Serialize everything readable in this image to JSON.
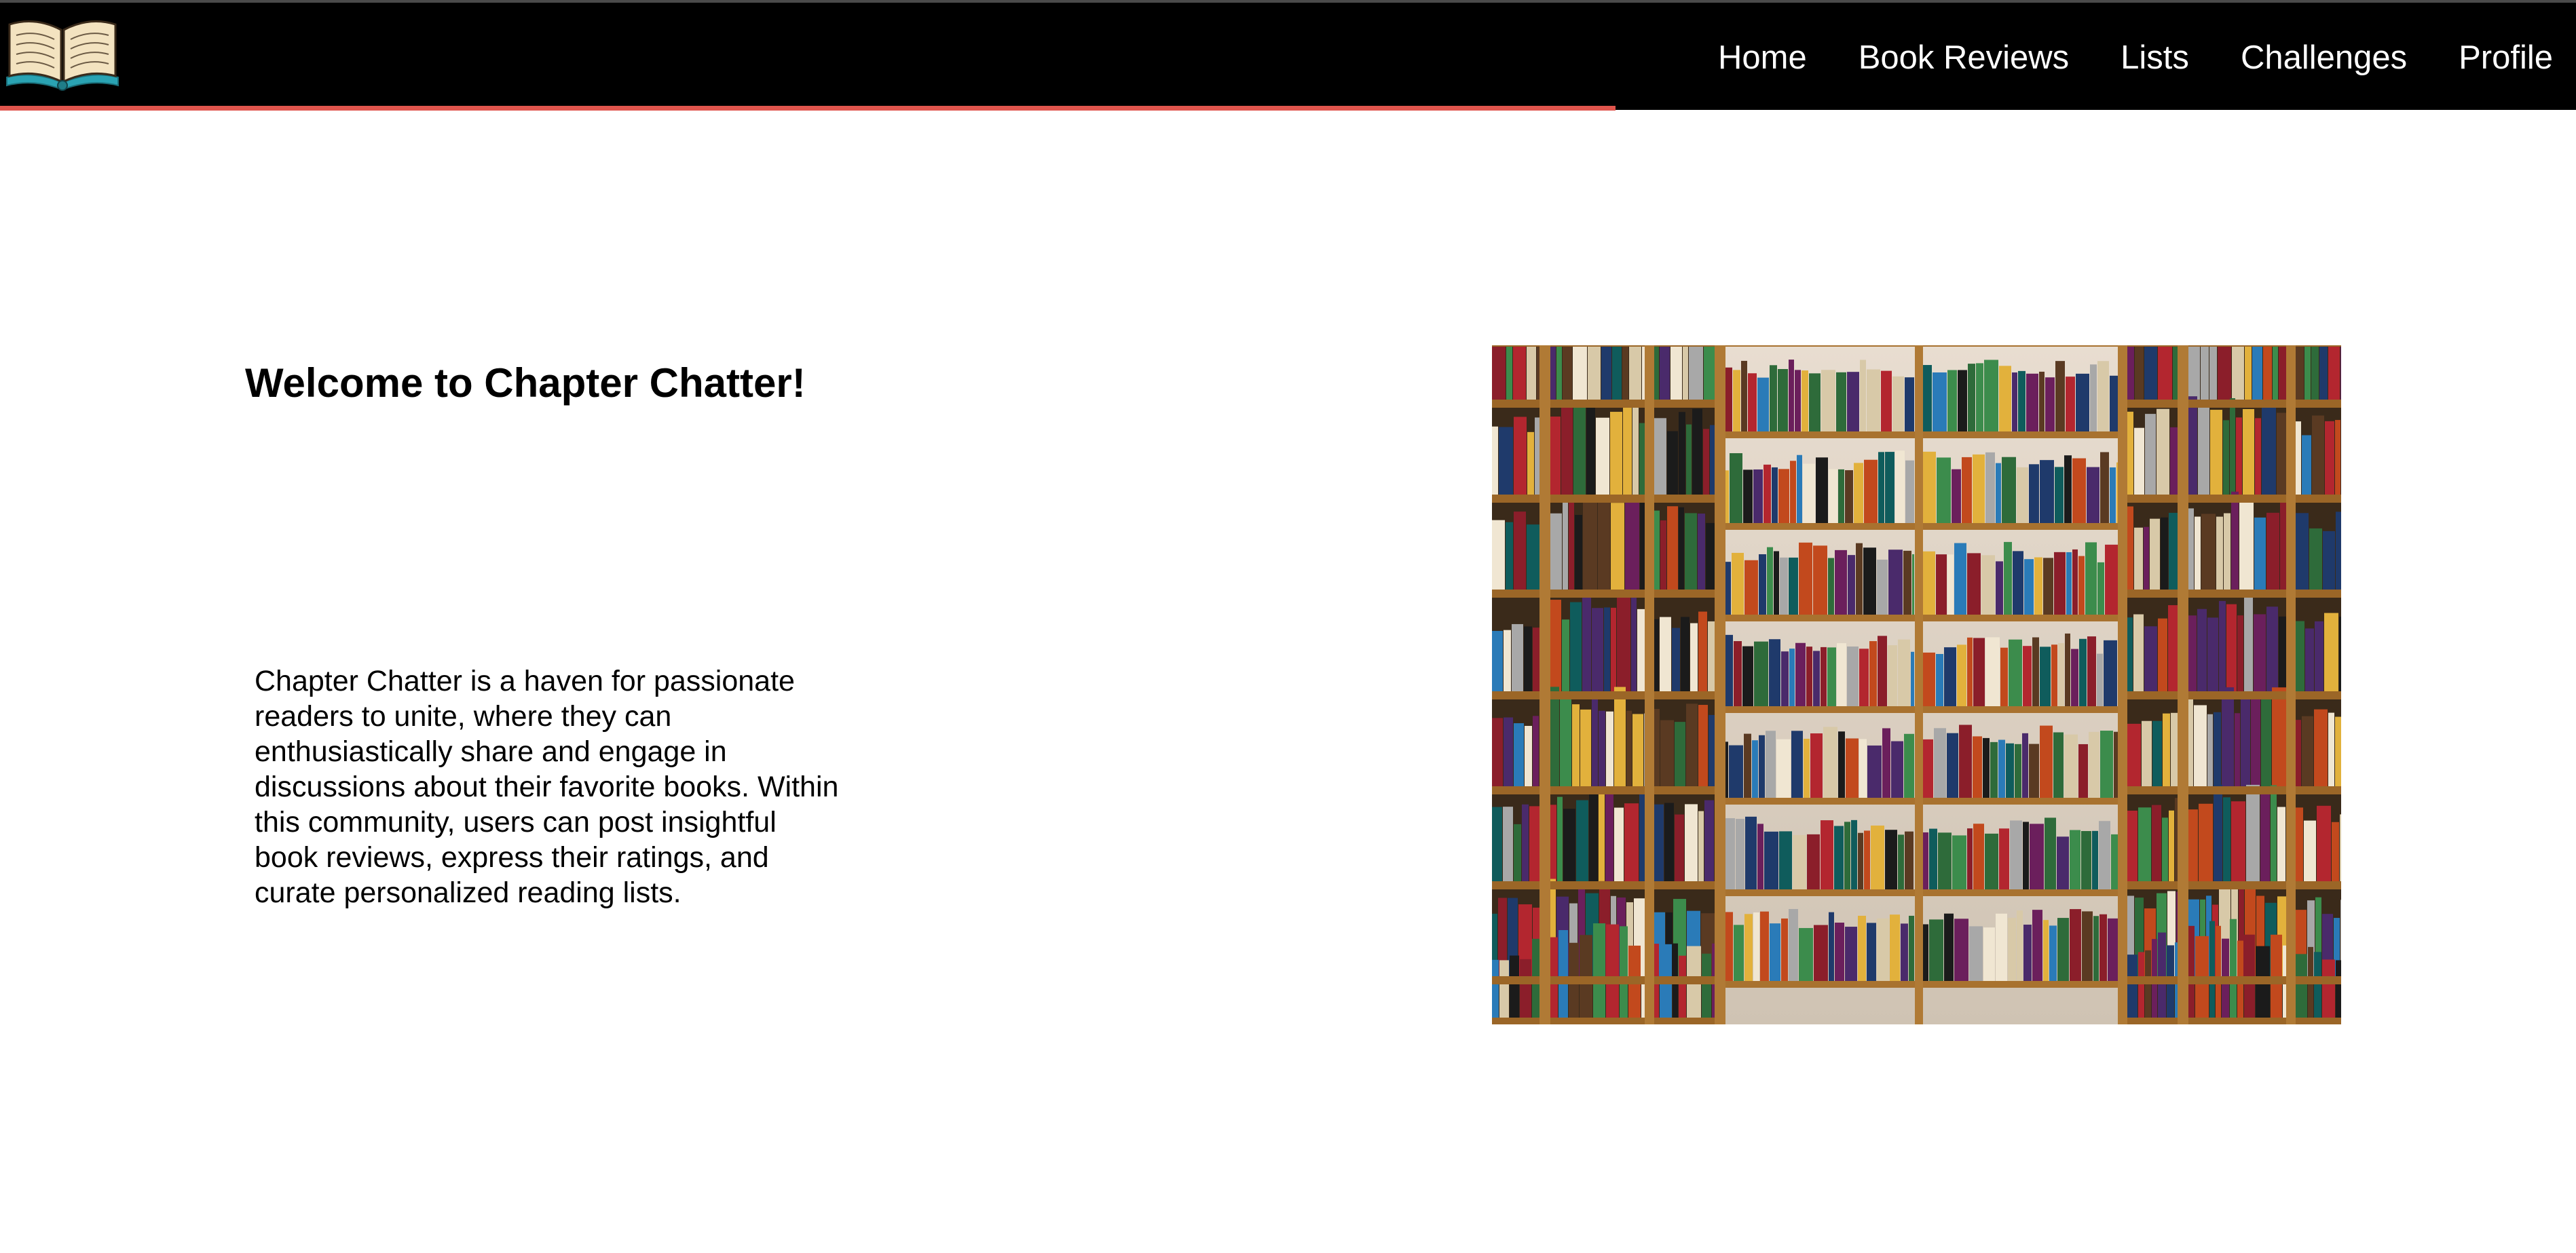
{
  "app": {
    "logo_icon": "open-book-icon"
  },
  "nav": {
    "items": [
      {
        "label": "Home"
      },
      {
        "label": "Book Reviews"
      },
      {
        "label": "Lists"
      },
      {
        "label": "Challenges"
      },
      {
        "label": "Profile"
      }
    ],
    "background": "#000000",
    "accent_color": "#e0554d"
  },
  "main": {
    "title": "Welcome to Chapter Chatter!",
    "description": "Chapter Chatter is a haven for passionate readers to unite, where they can enthusiastically share and engage in discussions about their favorite books. Within this community, users can post insightful book reviews, express their ratings, and curate personalized reading lists."
  }
}
